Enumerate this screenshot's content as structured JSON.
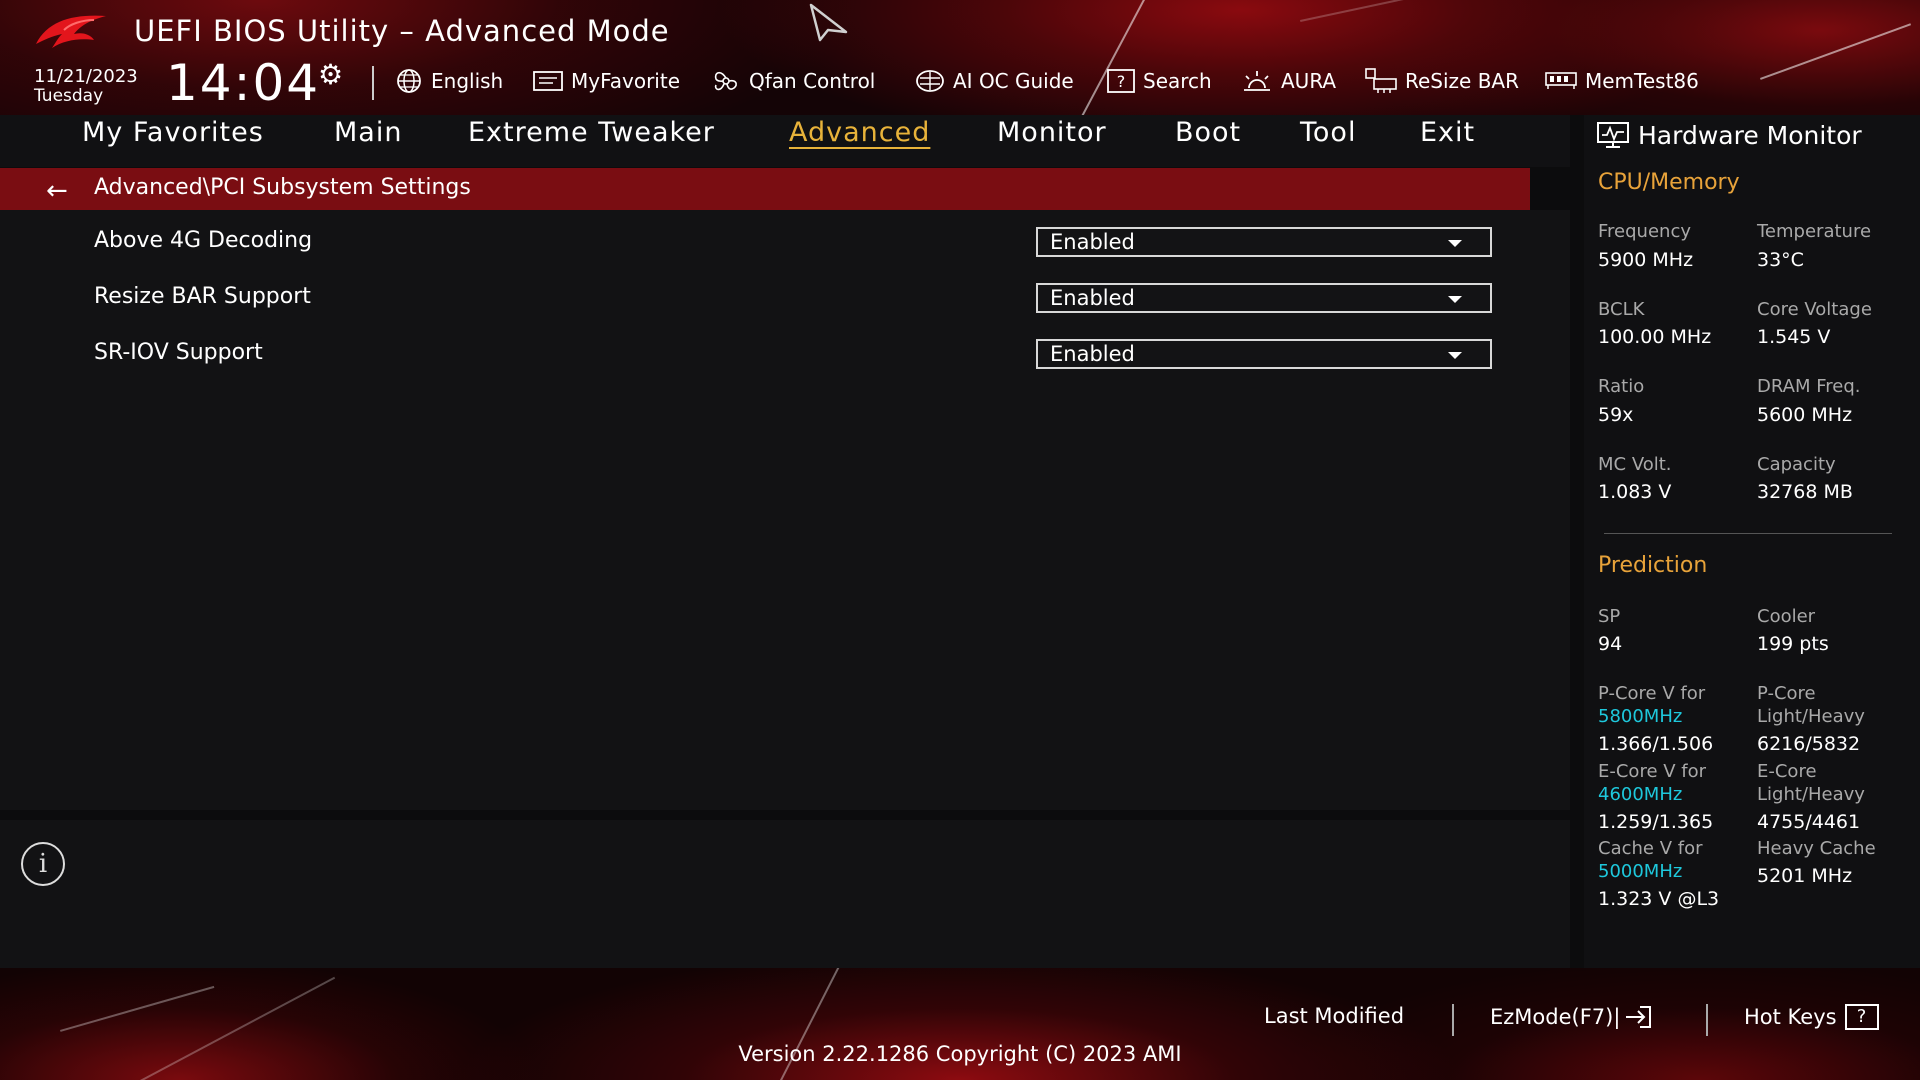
{
  "header": {
    "title": "UEFI BIOS Utility – Advanced Mode",
    "date": "11/21/2023",
    "day": "Tuesday",
    "time": "14:04",
    "toolbar": [
      {
        "label": "English",
        "icon": "globe-icon"
      },
      {
        "label": "MyFavorite",
        "icon": "favorite-icon"
      },
      {
        "label": "Qfan Control",
        "icon": "fan-icon"
      },
      {
        "label": "AI OC Guide",
        "icon": "ai-guide-icon"
      },
      {
        "label": "Search",
        "icon": "search-icon"
      },
      {
        "label": "AURA",
        "icon": "aura-icon"
      },
      {
        "label": "ReSize BAR",
        "icon": "resize-bar-icon"
      },
      {
        "label": "MemTest86",
        "icon": "memtest-icon"
      }
    ]
  },
  "menu": {
    "items": [
      "My Favorites",
      "Main",
      "Extreme Tweaker",
      "Advanced",
      "Monitor",
      "Boot",
      "Tool",
      "Exit"
    ],
    "active": "Advanced"
  },
  "breadcrumb": "Advanced\\PCI Subsystem Settings",
  "settings": [
    {
      "label": "Above 4G Decoding",
      "value": "Enabled"
    },
    {
      "label": "Resize BAR Support",
      "value": "Enabled"
    },
    {
      "label": "SR-IOV Support",
      "value": "Enabled"
    }
  ],
  "hardware_monitor": {
    "title": "Hardware Monitor",
    "cpu_memory": {
      "heading": "CPU/Memory",
      "items": [
        {
          "label": "Frequency",
          "value": "5900 MHz"
        },
        {
          "label": "Temperature",
          "value": "33°C"
        },
        {
          "label": "BCLK",
          "value": "100.00 MHz"
        },
        {
          "label": "Core Voltage",
          "value": "1.545 V"
        },
        {
          "label": "Ratio",
          "value": "59x"
        },
        {
          "label": "DRAM Freq.",
          "value": "5600 MHz"
        },
        {
          "label": "MC Volt.",
          "value": "1.083 V"
        },
        {
          "label": "Capacity",
          "value": "32768 MB"
        }
      ]
    },
    "prediction": {
      "heading": "Prediction",
      "sp_label": "SP",
      "sp_value": "94",
      "cooler_label": "Cooler",
      "cooler_value": "199 pts",
      "pcore_v_label": "P-Core V for",
      "pcore_v_freq": "5800MHz",
      "pcore_v_value": "1.366/1.506",
      "pcore_lh_label1": "P-Core",
      "pcore_lh_label2": "Light/Heavy",
      "pcore_lh_value": "6216/5832",
      "ecore_v_label": "E-Core V for",
      "ecore_v_freq": "4600MHz",
      "ecore_v_value": "1.259/1.365",
      "ecore_lh_label1": "E-Core",
      "ecore_lh_label2": "Light/Heavy",
      "ecore_lh_value": "4755/4461",
      "cache_v_label": "Cache V for",
      "cache_v_freq": "5000MHz",
      "cache_v_value": "1.323 V @L3",
      "heavy_cache_label": "Heavy Cache",
      "heavy_cache_value": "5201 MHz"
    }
  },
  "footer": {
    "last_modified": "Last Modified",
    "ezmode": "EzMode(F7)|",
    "hotkeys": "Hot Keys",
    "hotkeys_glyph": "?",
    "version": "Version 2.22.1286 Copyright (C) 2023 AMI"
  },
  "colors": {
    "accent_gold": "#e8a33a",
    "accent_cyan": "#1ec8dc",
    "breadcrumb_red": "#7a0d12"
  }
}
